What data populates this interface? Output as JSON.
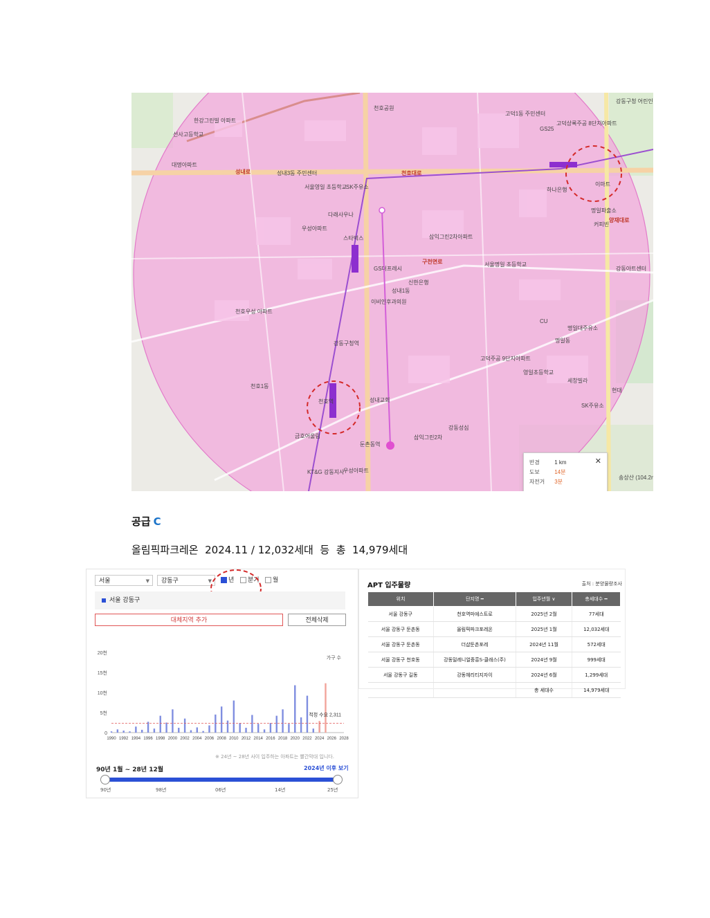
{
  "map": {
    "info": {
      "radius_label": "반경",
      "radius_value": "1 km",
      "walk_label": "도보",
      "walk_value": "14분",
      "bike_label": "자전거",
      "bike_value": "3분",
      "close": "✕"
    },
    "road_labels": [
      "천호대로",
      "성내로",
      "양재대로",
      "구천면로"
    ],
    "labels": [
      "강동구청 어린인원실",
      "고덕1동 주민센터",
      "고덕상록주공 8단지아파트",
      "GS25",
      "천호공원",
      "성내3동 주민센터",
      "서울영일 초등학교",
      "SK주유소",
      "다래사우나",
      "우성아파트",
      "스타벅스",
      "GS더프레시",
      "신한은행",
      "이비인후과의원",
      "성내1동",
      "강동구청역",
      "천호역",
      "강동성심",
      "금호어울림",
      "둔촌동역",
      "KT&G 강동지사",
      "우성아파트",
      "명일동",
      "하나은행",
      "명일파출소",
      "커피빈",
      "서울명일 초등학교",
      "강동아트센터",
      "삼익그린2차아파트",
      "고덕주공 9단지아파트",
      "CU",
      "이마트",
      "세창빌라",
      "현대",
      "SK주유소",
      "송상산 (104.2m)",
      "명일대주유소",
      "삼익그린2차",
      "영일초등학교",
      "선사고등학교",
      "천호1동",
      "성내교회",
      "천호우성 아파트",
      "대명아파트",
      "한강그린빌 아파트"
    ]
  },
  "supply": {
    "heading": "공급",
    "heading_tag": "C",
    "line": "올림픽파크레온  2024.11 / 12,032세대  등  총  14,979세대"
  },
  "left_panel": {
    "select_city": "서울",
    "select_district": "강동구",
    "radio_year": "년",
    "radio_quarter": "분기",
    "radio_month": "월",
    "region_item": "서울 강동구",
    "add_button": "대체지역 추가",
    "delete_button": "전체삭제",
    "chart_legend": "가구 수",
    "demand_label": "적정 수요 2,311",
    "note": "※ 24년 ~ 28년 사이 입주하는 아파트는 빨간막대 입니다.",
    "range_title": "90년 1월 ~ 28년 12월",
    "range_link": "2024년 이후 보기",
    "slider_ticks": [
      "90년",
      "98년",
      "06년",
      "14년",
      "25년"
    ]
  },
  "right_panel": {
    "title": "APT 입주물량",
    "source": "출처 : 분양물량조사",
    "headers": [
      "위치",
      "단지명 ━",
      "입주년월 ∨",
      "총세대수 ━"
    ],
    "rows": [
      [
        "서울 강동구",
        "천호역마에스트로",
        "2025년 2월",
        "77세대"
      ],
      [
        "서울 강동구 둔촌동",
        "올림픽파크포레온",
        "2025년 1월",
        "12,032세대"
      ],
      [
        "서울 강동구 둔촌동",
        "더샵둔촌포레",
        "2024년 11월",
        "572세대"
      ],
      [
        "서울 강동구 천호동",
        "강동밀레니얼중흥S-클래스(주)",
        "2024년 9월",
        "999세대"
      ],
      [
        "서울 강동구 길동",
        "강동헤리티지자이",
        "2024년 6월",
        "1,299세대"
      ]
    ],
    "total_label": "총 세대수",
    "total_value": "14,979세대"
  },
  "chart_data": {
    "type": "bar",
    "title": "",
    "xlabel": "",
    "ylabel": "가구 수",
    "y_tick_labels": [
      "0",
      "5천",
      "10천",
      "15천",
      "20천"
    ],
    "ylim": [
      0,
      20000
    ],
    "x_tick_labels": [
      "1990",
      "1992",
      "1994",
      "1996",
      "1998",
      "2000",
      "2002",
      "2004",
      "2006",
      "2008",
      "2010",
      "2012",
      "2014",
      "2016",
      "2018",
      "2020",
      "2022",
      "2024",
      "2026",
      "2028"
    ],
    "categories": [
      1990,
      1991,
      1992,
      1993,
      1994,
      1995,
      1996,
      1997,
      1998,
      1999,
      2000,
      2001,
      2002,
      2003,
      2004,
      2005,
      2006,
      2007,
      2008,
      2009,
      2010,
      2011,
      2012,
      2013,
      2014,
      2015,
      2016,
      2017,
      2018,
      2019,
      2020,
      2021,
      2022,
      2023,
      2024,
      2025,
      2026,
      2027,
      2028
    ],
    "series": [
      {
        "color": "#7f8ee0",
        "values": [
          300,
          800,
          500,
          300,
          1500,
          700,
          2700,
          1000,
          4200,
          2500,
          5800,
          1200,
          3500,
          600,
          1300,
          400,
          1800,
          4500,
          6500,
          3000,
          8000,
          2400,
          1200,
          4400,
          2200,
          800,
          2400,
          4200,
          5800,
          2200,
          11800,
          3800,
          9200,
          1000,
          2500,
          0,
          0,
          0,
          0
        ]
      },
      {
        "color": "#f2a49a",
        "values": [
          0,
          0,
          0,
          0,
          0,
          0,
          0,
          0,
          0,
          0,
          0,
          0,
          0,
          0,
          0,
          0,
          0,
          0,
          0,
          0,
          0,
          0,
          0,
          0,
          0,
          0,
          0,
          0,
          0,
          0,
          0,
          0,
          0,
          0,
          2900,
          12300,
          0,
          0,
          0
        ]
      }
    ],
    "reference_line": {
      "label": "적정 수요 2,311",
      "value": 2311,
      "color": "#e05555"
    },
    "grid": false
  }
}
